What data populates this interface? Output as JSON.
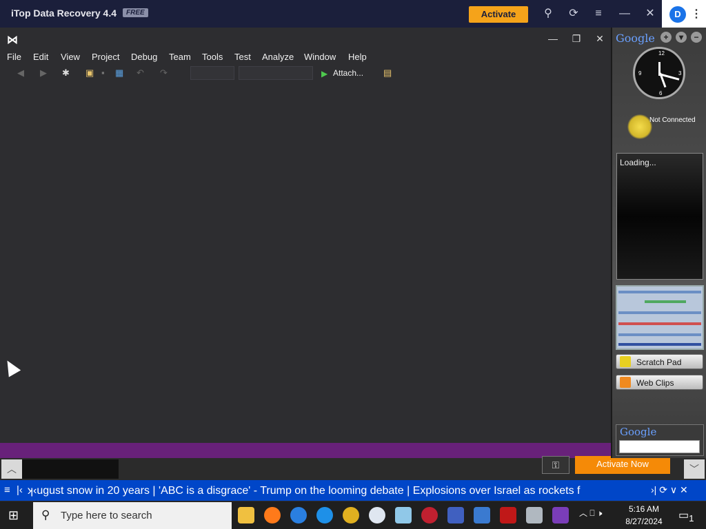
{
  "itop": {
    "title": "iTop Data Recovery 4.4",
    "badge": "FREE",
    "activate_label": "Activate",
    "icons": [
      "key-icon",
      "refresh-icon",
      "menu-icon",
      "minimize-icon",
      "close-icon"
    ]
  },
  "vs": {
    "menu": [
      "File",
      "Edit",
      "View",
      "Project",
      "Debug",
      "Team",
      "Tools",
      "Test",
      "Analyze",
      "Window",
      "Help"
    ],
    "attach_label": "Attach...",
    "status_color": "#68217a"
  },
  "activate_now_label": "Activate Now",
  "ticker": {
    "text": "ʞ‹ugust snow in 20 years   |   'ABC is a disgrace' - Trump on the looming debate   |   Explosions over Israel as rockets f"
  },
  "taskbar": {
    "search_placeholder": "Type here to search",
    "time": "5:16 AM",
    "date": "8/27/2024",
    "notification_count": "1"
  },
  "sidebar": {
    "google_logo": "Google",
    "weather_status": "Not Connected",
    "feed_loading": "Loading...",
    "scratch_pad": "Scratch Pad",
    "web_clips": "Web Clips",
    "search_logo": "Google"
  }
}
